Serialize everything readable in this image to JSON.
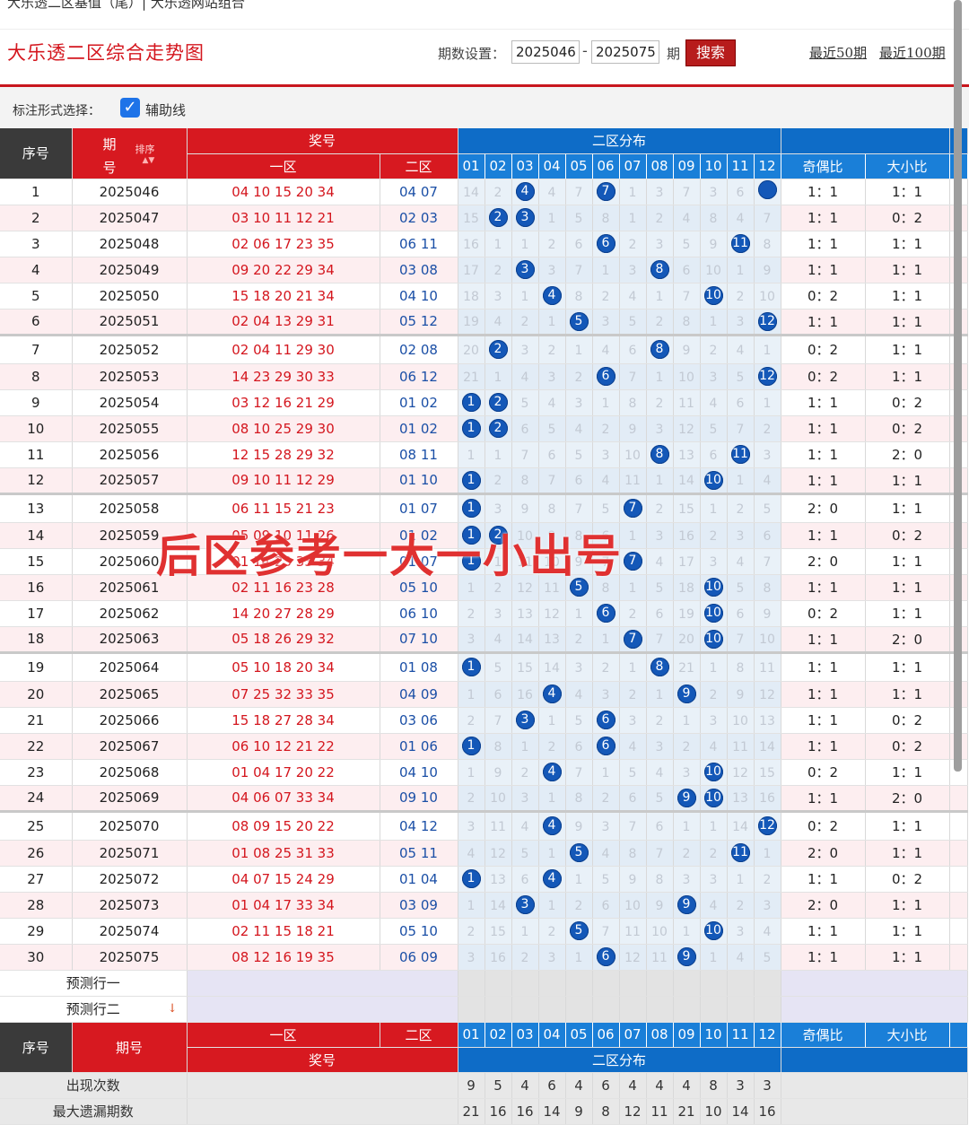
{
  "breadcrumb": "大乐透二区基值（尾）| 大乐透网站组合",
  "header": {
    "title": "大乐透二区综合走势图",
    "period_label": "期数设置：",
    "period_from": "2025046",
    "period_to": "2025075",
    "period_unit": "期",
    "search_label": "搜索",
    "recent50": "最近50期",
    "recent100": "最近100期"
  },
  "mark": {
    "label": "标注形式选择：",
    "aux_line_label": "辅助线",
    "aux_line_checked": true
  },
  "table": {
    "head": {
      "idx": "序号",
      "period": "期号",
      "sort": "排序",
      "prize": "奖号",
      "zone1": "一区",
      "zone2": "二区",
      "dist": "二区分布",
      "odd_even": "奇偶比",
      "big_small": "大小比",
      "balls": [
        "01",
        "02",
        "03",
        "04",
        "05",
        "06",
        "07",
        "08",
        "09",
        "10",
        "11",
        "12"
      ]
    },
    "rows": [
      {
        "idx": "1",
        "period": "2025046",
        "a": "04 10 15 20 34",
        "b": "04 07",
        "d": [
          "14",
          "2",
          "*4",
          "4",
          "7",
          "*7",
          "1",
          "3",
          "7",
          "3",
          "6",
          "*"
        ],
        "oe": "1：1",
        "bs": "1：1"
      },
      {
        "idx": "2",
        "period": "2025047",
        "a": "03 10 11 12 21",
        "b": "02 03",
        "d": [
          "15",
          "*2",
          "*3",
          "1",
          "5",
          "8",
          "1",
          "2",
          "4",
          "8",
          "4",
          "7"
        ],
        "oe": "1：1",
        "bs": "0：2"
      },
      {
        "idx": "3",
        "period": "2025048",
        "a": "02 06 17 23 35",
        "b": "06 11",
        "d": [
          "16",
          "1",
          "1",
          "2",
          "6",
          "*6",
          "2",
          "3",
          "5",
          "9",
          "*11",
          "8"
        ],
        "oe": "1：1",
        "bs": "1：1"
      },
      {
        "idx": "4",
        "period": "2025049",
        "a": "09 20 22 29 34",
        "b": "03 08",
        "d": [
          "17",
          "2",
          "*3",
          "3",
          "7",
          "1",
          "3",
          "*8",
          "6",
          "10",
          "1",
          "9"
        ],
        "oe": "1：1",
        "bs": "1：1"
      },
      {
        "idx": "5",
        "period": "2025050",
        "a": "15 18 20 21 34",
        "b": "04 10",
        "d": [
          "18",
          "3",
          "1",
          "*4",
          "8",
          "2",
          "4",
          "1",
          "7",
          "*10",
          "2",
          "10"
        ],
        "oe": "0：2",
        "bs": "1：1"
      },
      {
        "idx": "6",
        "period": "2025051",
        "a": "02 04 13 29 31",
        "b": "05 12",
        "d": [
          "19",
          "4",
          "2",
          "1",
          "*5",
          "3",
          "5",
          "2",
          "8",
          "1",
          "3",
          "*12"
        ],
        "oe": "1：1",
        "bs": "1：1"
      },
      {
        "idx": "7",
        "period": "2025052",
        "a": "02 04 11 29 30",
        "b": "02 08",
        "d": [
          "20",
          "*2",
          "3",
          "2",
          "1",
          "4",
          "6",
          "*8",
          "9",
          "2",
          "4",
          "1"
        ],
        "oe": "0：2",
        "bs": "1：1"
      },
      {
        "idx": "8",
        "period": "2025053",
        "a": "14 23 29 30 33",
        "b": "06 12",
        "d": [
          "21",
          "1",
          "4",
          "3",
          "2",
          "*6",
          "7",
          "1",
          "10",
          "3",
          "5",
          "*12"
        ],
        "oe": "0：2",
        "bs": "1：1"
      },
      {
        "idx": "9",
        "period": "2025054",
        "a": "03 12 16 21 29",
        "b": "01 02",
        "d": [
          "*1",
          "*2",
          "5",
          "4",
          "3",
          "1",
          "8",
          "2",
          "11",
          "4",
          "6",
          "1"
        ],
        "oe": "1：1",
        "bs": "0：2"
      },
      {
        "idx": "10",
        "period": "2025055",
        "a": "08 10 25 29 30",
        "b": "01 02",
        "d": [
          "*1",
          "*2",
          "6",
          "5",
          "4",
          "2",
          "9",
          "3",
          "12",
          "5",
          "7",
          "2"
        ],
        "oe": "1：1",
        "bs": "0：2"
      },
      {
        "idx": "11",
        "period": "2025056",
        "a": "12 15 28 29 32",
        "b": "08 11",
        "d": [
          "1",
          "1",
          "7",
          "6",
          "5",
          "3",
          "10",
          "*8",
          "13",
          "6",
          "*11",
          "3"
        ],
        "oe": "1：1",
        "bs": "2：0"
      },
      {
        "idx": "12",
        "period": "2025057",
        "a": "09 10 11 12 29",
        "b": "01 10",
        "d": [
          "*1",
          "2",
          "8",
          "7",
          "6",
          "4",
          "11",
          "1",
          "14",
          "*10",
          "1",
          "4"
        ],
        "oe": "1：1",
        "bs": "1：1"
      },
      {
        "idx": "13",
        "period": "2025058",
        "a": "06 11 15 21 23",
        "b": "01 07",
        "d": [
          "*1",
          "3",
          "9",
          "8",
          "7",
          "5",
          "*7",
          "2",
          "15",
          "1",
          "2",
          "5"
        ],
        "oe": "2：0",
        "bs": "1：1"
      },
      {
        "idx": "14",
        "period": "2025059",
        "a": "05 09 10 11 26",
        "b": "01 02",
        "d": [
          "*1",
          "*2",
          "10",
          "9",
          "8",
          "6",
          "1",
          "3",
          "16",
          "2",
          "3",
          "6"
        ],
        "oe": "1：1",
        "bs": "0：2"
      },
      {
        "idx": "15",
        "period": "2025060",
        "a": "01 14 23 33 34",
        "b": "01 07",
        "d": [
          "*1",
          "1",
          "11",
          "10",
          "9",
          "7",
          "*7",
          "4",
          "17",
          "3",
          "4",
          "7"
        ],
        "oe": "2：0",
        "bs": "1：1"
      },
      {
        "idx": "16",
        "period": "2025061",
        "a": "02 11 16 23 28",
        "b": "05 10",
        "d": [
          "1",
          "2",
          "12",
          "11",
          "*5",
          "8",
          "1",
          "5",
          "18",
          "*10",
          "5",
          "8"
        ],
        "oe": "1：1",
        "bs": "1：1"
      },
      {
        "idx": "17",
        "period": "2025062",
        "a": "14 20 27 28 29",
        "b": "06 10",
        "d": [
          "2",
          "3",
          "13",
          "12",
          "1",
          "*6",
          "2",
          "6",
          "19",
          "*10",
          "6",
          "9"
        ],
        "oe": "0：2",
        "bs": "1：1"
      },
      {
        "idx": "18",
        "period": "2025063",
        "a": "05 18 26 29 32",
        "b": "07 10",
        "d": [
          "3",
          "4",
          "14",
          "13",
          "2",
          "1",
          "*7",
          "7",
          "20",
          "*10",
          "7",
          "10"
        ],
        "oe": "1：1",
        "bs": "2：0"
      },
      {
        "idx": "19",
        "period": "2025064",
        "a": "05 10 18 20 34",
        "b": "01 08",
        "d": [
          "*1",
          "5",
          "15",
          "14",
          "3",
          "2",
          "1",
          "*8",
          "21",
          "1",
          "8",
          "11"
        ],
        "oe": "1：1",
        "bs": "1：1"
      },
      {
        "idx": "20",
        "period": "2025065",
        "a": "07 25 32 33 35",
        "b": "04 09",
        "d": [
          "1",
          "6",
          "16",
          "*4",
          "4",
          "3",
          "2",
          "1",
          "*9",
          "2",
          "9",
          "12"
        ],
        "oe": "1：1",
        "bs": "1：1"
      },
      {
        "idx": "21",
        "period": "2025066",
        "a": "15 18 27 28 34",
        "b": "03 06",
        "d": [
          "2",
          "7",
          "*3",
          "1",
          "5",
          "*6",
          "3",
          "2",
          "1",
          "3",
          "10",
          "13"
        ],
        "oe": "1：1",
        "bs": "0：2"
      },
      {
        "idx": "22",
        "period": "2025067",
        "a": "06 10 12 21 22",
        "b": "01 06",
        "d": [
          "*1",
          "8",
          "1",
          "2",
          "6",
          "*6",
          "4",
          "3",
          "2",
          "4",
          "11",
          "14"
        ],
        "oe": "1：1",
        "bs": "0：2"
      },
      {
        "idx": "23",
        "period": "2025068",
        "a": "01 04 17 20 22",
        "b": "04 10",
        "d": [
          "1",
          "9",
          "2",
          "*4",
          "7",
          "1",
          "5",
          "4",
          "3",
          "*10",
          "12",
          "15"
        ],
        "oe": "0：2",
        "bs": "1：1"
      },
      {
        "idx": "24",
        "period": "2025069",
        "a": "04 06 07 33 34",
        "b": "09 10",
        "d": [
          "2",
          "10",
          "3",
          "1",
          "8",
          "2",
          "6",
          "5",
          "*9",
          "*10",
          "13",
          "16"
        ],
        "oe": "1：1",
        "bs": "2：0"
      },
      {
        "idx": "25",
        "period": "2025070",
        "a": "08 09 15 20 22",
        "b": "04 12",
        "d": [
          "3",
          "11",
          "4",
          "*4",
          "9",
          "3",
          "7",
          "6",
          "1",
          "1",
          "14",
          "*12"
        ],
        "oe": "0：2",
        "bs": "1：1"
      },
      {
        "idx": "26",
        "period": "2025071",
        "a": "01 08 25 31 33",
        "b": "05 11",
        "d": [
          "4",
          "12",
          "5",
          "1",
          "*5",
          "4",
          "8",
          "7",
          "2",
          "2",
          "*11",
          "1"
        ],
        "oe": "2：0",
        "bs": "1：1"
      },
      {
        "idx": "27",
        "period": "2025072",
        "a": "04 07 15 24 29",
        "b": "01 04",
        "d": [
          "*1",
          "13",
          "6",
          "*4",
          "1",
          "5",
          "9",
          "8",
          "3",
          "3",
          "1",
          "2"
        ],
        "oe": "1：1",
        "bs": "0：2"
      },
      {
        "idx": "28",
        "period": "2025073",
        "a": "01 04 17 33 34",
        "b": "03 09",
        "d": [
          "1",
          "14",
          "*3",
          "1",
          "2",
          "6",
          "10",
          "9",
          "*9",
          "4",
          "2",
          "3"
        ],
        "oe": "2：0",
        "bs": "1：1"
      },
      {
        "idx": "29",
        "period": "2025074",
        "a": "02 11 15 18 21",
        "b": "05 10",
        "d": [
          "2",
          "15",
          "1",
          "2",
          "*5",
          "7",
          "11",
          "10",
          "1",
          "*10",
          "3",
          "4"
        ],
        "oe": "1：1",
        "bs": "1：1"
      },
      {
        "idx": "30",
        "period": "2025075",
        "a": "08 12 16 19 35",
        "b": "06 09",
        "d": [
          "3",
          "16",
          "2",
          "3",
          "1",
          "*6",
          "12",
          "11",
          "*9",
          "1",
          "4",
          "5"
        ],
        "oe": "1：1",
        "bs": "1：1"
      }
    ],
    "predict1": "预测行一",
    "predict2": "预测行二",
    "predict_arrow": "↓",
    "stats": {
      "occur_label": "出现次数",
      "occur": [
        "9",
        "5",
        "4",
        "6",
        "4",
        "6",
        "4",
        "4",
        "4",
        "8",
        "3",
        "3"
      ],
      "maxmiss_label": "最大遗漏期数",
      "maxmiss": [
        "21",
        "16",
        "16",
        "14",
        "9",
        "8",
        "12",
        "11",
        "21",
        "10",
        "14",
        "16"
      ]
    }
  },
  "watermark": "后区参考一大一小出号",
  "colors": {
    "accent_red": "#d71920",
    "accent_blue": "#0e6cc7",
    "ball": "#1458b8"
  }
}
